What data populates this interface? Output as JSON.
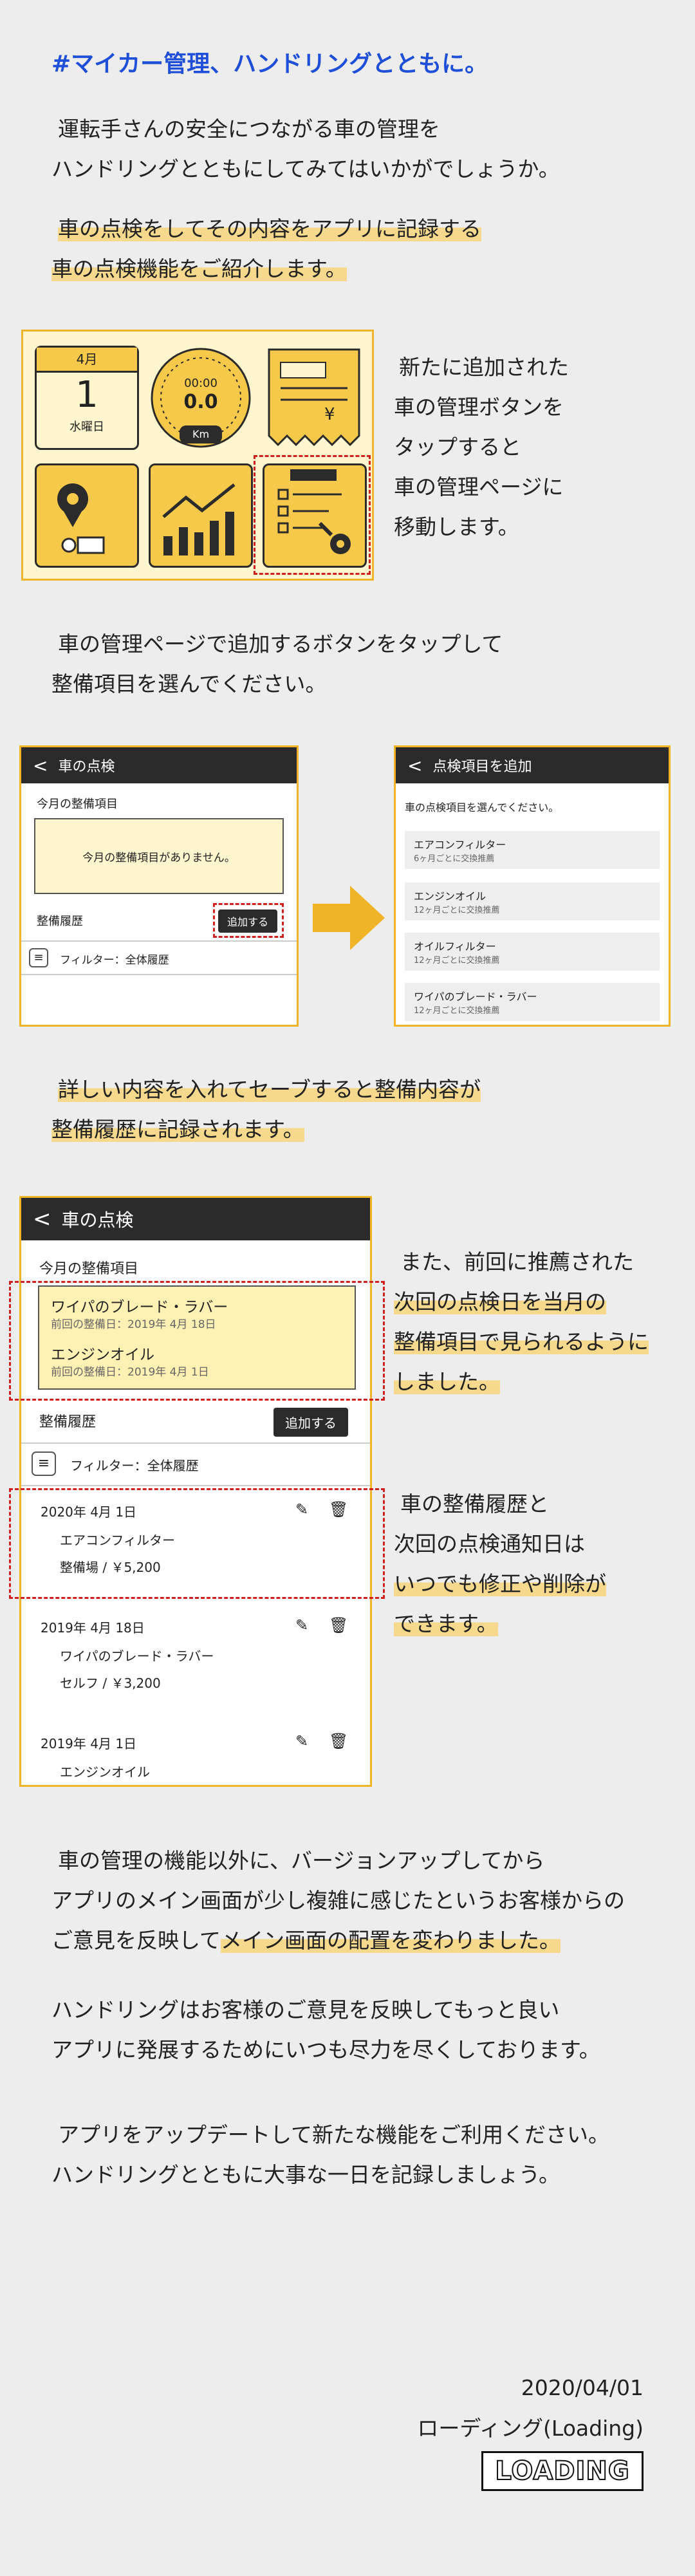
{
  "title": "#マイカー管理、ハンドリングとともに。",
  "intro": {
    "line1": "運転手さんの安全につながる車の管理を",
    "line2": "ハンドリングとともにしてみてはいかがでしょうか。"
  },
  "feature": {
    "line1": "車の点検をしてその内容をアプリに記録する",
    "line2": "車の点検機能をご紹介します。"
  },
  "icons": {
    "calendar_month": "4月",
    "calendar_day": "1",
    "calendar_weekday": "水曜日",
    "gauge_time": "00:00",
    "gauge_value": "0.0",
    "gauge_unit": "Km",
    "receipt_currency": "¥"
  },
  "desc1": {
    "line1": "新たに追加された",
    "line2": "車の管理ボタンを",
    "line3": "タップすると",
    "line4": "車の管理ページに",
    "line5": "移動します。"
  },
  "step2": {
    "line1": "車の管理ページで追加するボタンをタップして",
    "line2": "整備項目を選んでください。"
  },
  "screenA": {
    "title": "車の点検",
    "section": "今月の整備項目",
    "empty": "今月の整備項目がありません。",
    "history": "整備履歴",
    "add_button": "追加する",
    "filter": "フィルター：全体履歴"
  },
  "screenB": {
    "title": "点検項目を追加",
    "prompt": "車の点検項目を選んでください。",
    "items": [
      {
        "name": "エアコンフィルター",
        "note": "6ヶ月ごとに交換推薦"
      },
      {
        "name": "エンジンオイル",
        "note": "12ヶ月ごとに交換推薦"
      },
      {
        "name": "オイルフィルター",
        "note": "12ヶ月ごとに交換推薦"
      },
      {
        "name": "ワイパのブレード・ラバー",
        "note": "12ヶ月ごとに交換推薦"
      }
    ]
  },
  "step3": {
    "line1": "詳しい内容を入れてセーブすると整備内容が",
    "line2": "整備履歴に記録されます。"
  },
  "screenC": {
    "title": "車の点検",
    "section": "今月の整備項目",
    "month_items": [
      {
        "name": "ワイパのブレード・ラバー",
        "note": "前回の整備日：2019年 4月 18日"
      },
      {
        "name": "エンジンオイル",
        "note": "前回の整備日：2019年 4月 1日"
      }
    ],
    "history": "整備履歴",
    "add_button": "追加する",
    "filter": "フィルター：全体履歴",
    "records": [
      {
        "date": "2020年 4月 1日",
        "item": "エアコンフィルター",
        "detail": "整備場 / ￥5,200"
      },
      {
        "date": "2019年 4月 18日",
        "item": "ワイパのブレード・ラバー",
        "detail": "セルフ / ￥3,200"
      },
      {
        "date": "2019年 4月 1日",
        "item": "エンジンオイル",
        "detail": ""
      }
    ]
  },
  "desc2": {
    "line1": "また、前回に推薦された",
    "line2": "次回の点検日を当月の",
    "line3": "整備項目で見られるように",
    "line4": "しました。"
  },
  "desc3": {
    "line1": "車の整備履歴と",
    "line2": "次回の点検通知日は",
    "line3": "いつでも修正や削除が",
    "line4": "できます。"
  },
  "outro1": {
    "line1": "車の管理の機能以外に、バージョンアップしてから",
    "line2": "アプリのメイン画面が少し複雑に感じたというお客様からの",
    "line3a": "ご意見を反映して",
    "line3b": "メイン画面の配置を変わりました。"
  },
  "outro2": {
    "line1": "ハンドリングはお客様のご意見を反映してもっと良い",
    "line2": "アプリに発展するためにいつも尽力を尽くしております。"
  },
  "outro3": {
    "line1": "アプリをアップデートして新たな機能をご利用ください。",
    "line2": "ハンドリングとともに大事な一日を記録しましょう。"
  },
  "footer": {
    "date": "2020/04/01",
    "author": "ローディング(Loading)",
    "logo": "LOADING"
  },
  "colors": {
    "accent_title": "#1f4fd8",
    "highlight": "#f6d98c",
    "frame": "#f0b429",
    "dashed": "#d31e1e",
    "dark_bar": "#2b2b2b",
    "icon_fill": "#f6c94a"
  }
}
